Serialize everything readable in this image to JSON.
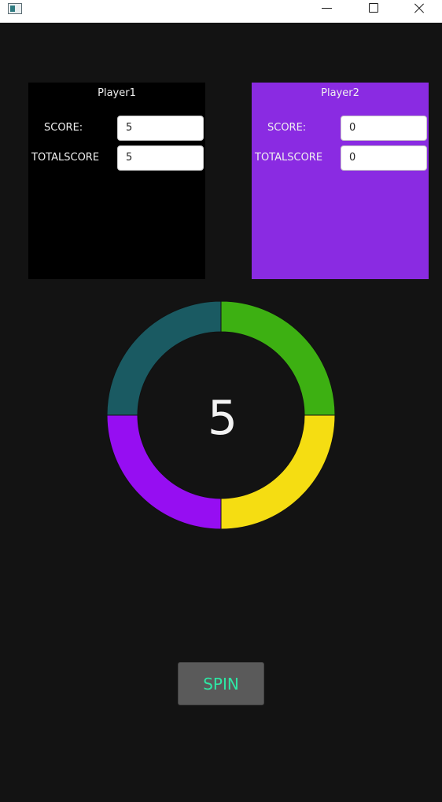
{
  "window": {
    "icon": "app-window-icon",
    "controls": [
      "minimize-icon",
      "maximize-icon",
      "close-icon"
    ]
  },
  "player1": {
    "title": "Player1",
    "score_label": "SCORE:",
    "score_value": "5",
    "total_label": "TOTALSCORE",
    "total_value": "5",
    "bg_color": "#000000"
  },
  "player2": {
    "title": "Player2",
    "score_label": "SCORE:",
    "score_value": "0",
    "total_label": "TOTALSCORE",
    "total_value": "0",
    "bg_color": "#8a2be2"
  },
  "wheel": {
    "value": "5",
    "segments": [
      {
        "color": "#3db012"
      },
      {
        "color": "#f5dd12"
      },
      {
        "color": "#960ef2"
      },
      {
        "color": "#1a5a62"
      }
    ]
  },
  "spin_button": {
    "label": "SPIN",
    "text_color": "#2ee8a5"
  }
}
